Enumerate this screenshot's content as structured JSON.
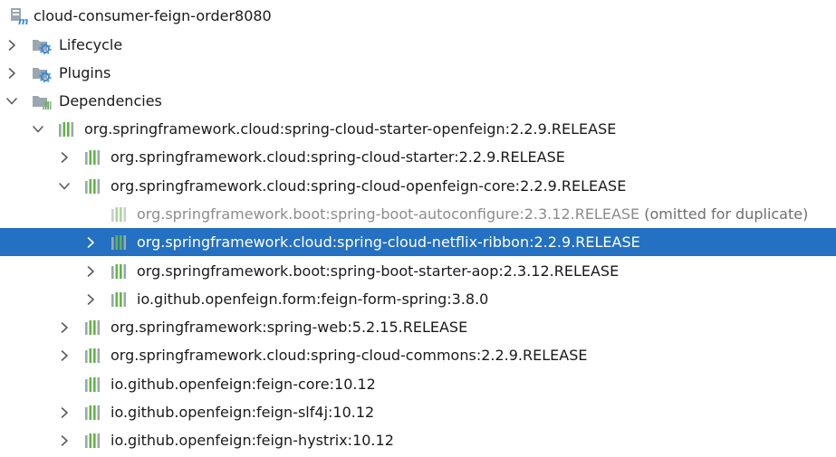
{
  "project": {
    "title": "cloud-consumer-feign-order8080",
    "icon": "maven-module-icon"
  },
  "nodes": [
    {
      "label": "Lifecycle",
      "icon": "folder-gear-icon",
      "expander": "collapsed"
    },
    {
      "label": "Plugins",
      "icon": "folder-gear-icon",
      "expander": "collapsed"
    },
    {
      "label": "Dependencies",
      "icon": "folder-library-icon",
      "expander": "expanded"
    },
    {
      "label": "org.springframework.cloud:spring-cloud-starter-openfeign:2.2.9.RELEASE",
      "icon": "library-icon",
      "expander": "expanded"
    },
    {
      "label": "org.springframework.cloud:spring-cloud-starter:2.2.9.RELEASE",
      "icon": "library-icon",
      "expander": "collapsed"
    },
    {
      "label": "org.springframework.cloud:spring-cloud-openfeign-core:2.2.9.RELEASE",
      "icon": "library-icon",
      "expander": "expanded"
    },
    {
      "label": "org.springframework.boot:spring-boot-autoconfigure:2.3.12.RELEASE",
      "suffix": " (omitted for duplicate)",
      "icon": "library-icon",
      "expander": "none",
      "state": "omitted"
    },
    {
      "label": "org.springframework.cloud:spring-cloud-netflix-ribbon:2.2.9.RELEASE",
      "icon": "library-icon",
      "expander": "collapsed",
      "state": "selected"
    },
    {
      "label": "org.springframework.boot:spring-boot-starter-aop:2.3.12.RELEASE",
      "icon": "library-icon",
      "expander": "collapsed"
    },
    {
      "label": "io.github.openfeign.form:feign-form-spring:3.8.0",
      "icon": "library-icon",
      "expander": "collapsed"
    },
    {
      "label": "org.springframework:spring-web:5.2.15.RELEASE",
      "icon": "library-icon",
      "expander": "collapsed"
    },
    {
      "label": "org.springframework.cloud:spring-cloud-commons:2.2.9.RELEASE",
      "icon": "library-icon",
      "expander": "collapsed"
    },
    {
      "label": "io.github.openfeign:feign-core:10.12",
      "icon": "library-icon",
      "expander": "none"
    },
    {
      "label": "io.github.openfeign:feign-slf4j:10.12",
      "icon": "library-icon",
      "expander": "collapsed"
    },
    {
      "label": "io.github.openfeign:feign-hystrix:10.12",
      "icon": "library-icon",
      "expander": "collapsed"
    }
  ],
  "colors": {
    "selection": "#2470c2",
    "library_green": "#62b543",
    "library_gray": "#9aa7b0",
    "module_blue": "#3d8ad9",
    "folder": "#9aa7b0",
    "gear": "#3d8ad9",
    "omitted_text": "#8c8c8c"
  }
}
